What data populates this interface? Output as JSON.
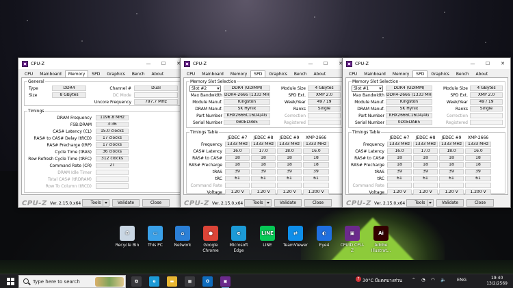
{
  "windows": [
    {
      "title": "CPU-Z",
      "active_tab": "Memory",
      "tabs": [
        "CPU",
        "Mainboard",
        "Memory",
        "SPD",
        "Graphics",
        "Bench",
        "About"
      ],
      "general": {
        "title": "General",
        "type_label": "Type",
        "type": "DDR4",
        "size_label": "Size",
        "size": "8 GBytes",
        "channel_label": "Channel #",
        "channel": "Dual",
        "dcmode_label": "DC Mode",
        "dcmode": "",
        "uncore_label": "Uncore Frequency",
        "uncore": "797.7 MHz"
      },
      "timings": {
        "title": "Timings",
        "rows": [
          {
            "label": "DRAM Frequency",
            "value": "1196.8 MHz",
            "disabled": false
          },
          {
            "label": "FSB:DRAM",
            "value": "3:36",
            "disabled": false
          },
          {
            "label": "CAS# Latency (CL)",
            "value": "15.0 clocks",
            "disabled": false
          },
          {
            "label": "RAS# to CAS# Delay (tRCD)",
            "value": "17 clocks",
            "disabled": false
          },
          {
            "label": "RAS# Precharge (tRP)",
            "value": "17 clocks",
            "disabled": false
          },
          {
            "label": "Cycle Time (tRAS)",
            "value": "36 clocks",
            "disabled": false
          },
          {
            "label": "Row Refresh Cycle Time (tRFC)",
            "value": "312 clocks",
            "disabled": false
          },
          {
            "label": "Command Rate (CR)",
            "value": "2T",
            "disabled": false
          },
          {
            "label": "DRAM Idle Timer",
            "value": "",
            "disabled": true
          },
          {
            "label": "Total CAS# (tRDRAM)",
            "value": "",
            "disabled": true
          },
          {
            "label": "Row To Column (tRCD)",
            "value": "",
            "disabled": true
          }
        ]
      },
      "footer": {
        "brand": "CPU-Z",
        "version": "Ver. 2.15.0.x64",
        "tools": "Tools",
        "validate": "Validate",
        "close": "Close"
      }
    },
    {
      "title": "CPU-Z",
      "active_tab": "SPD",
      "tabs": [
        "CPU",
        "Mainboard",
        "Memory",
        "SPD",
        "Graphics",
        "Bench",
        "About"
      ],
      "slot": {
        "group_title": "Memory Slot Selection",
        "slot": "Slot #2",
        "type": "DDR4 (UDIMM)",
        "left_rows": [
          {
            "label": "Max Bandwidth",
            "value": "DDR4-2666 (1333 MHz)"
          },
          {
            "label": "Module Manuf.",
            "value": "Kingston"
          },
          {
            "label": "DRAM Manuf.",
            "value": "SK Hynix"
          },
          {
            "label": "Part Number",
            "value": "KHX2666C16D4/4G"
          },
          {
            "label": "Serial Number",
            "value": "0B0ED3B5"
          }
        ],
        "right_rows": [
          {
            "label": "Module Size",
            "value": "4 GBytes",
            "disabled": false
          },
          {
            "label": "SPD Ext.",
            "value": "XMP 2.0",
            "disabled": false
          },
          {
            "label": "Week/Year",
            "value": "49 / 19",
            "disabled": false
          },
          {
            "label": "Ranks",
            "value": "Single",
            "disabled": false
          },
          {
            "label": "Correction",
            "value": "",
            "disabled": true
          },
          {
            "label": "Registered",
            "value": "",
            "disabled": true
          }
        ]
      },
      "timings_table": {
        "title": "Timings Table",
        "columns": [
          "JEDEC #7",
          "JEDEC #8",
          "JEDEC #9",
          "XMP-2666"
        ],
        "rows": [
          {
            "label": "Frequency",
            "values": [
              "1333 MHz",
              "1333 MHz",
              "1333 MHz",
              "1333 MHz"
            ],
            "disabled": false
          },
          {
            "label": "CAS# Latency",
            "values": [
              "16.0",
              "17.0",
              "18.0",
              "16.0"
            ],
            "disabled": false
          },
          {
            "label": "RAS# to CAS#",
            "values": [
              "18",
              "18",
              "18",
              "18"
            ],
            "disabled": false
          },
          {
            "label": "RAS# Precharge",
            "values": [
              "18",
              "18",
              "18",
              "18"
            ],
            "disabled": false
          },
          {
            "label": "tRAS",
            "values": [
              "39",
              "39",
              "39",
              "39"
            ],
            "disabled": false
          },
          {
            "label": "tRC",
            "values": [
              "61",
              "61",
              "61",
              "61"
            ],
            "disabled": false
          },
          {
            "label": "Command Rate",
            "values": [
              "",
              "",
              "",
              ""
            ],
            "disabled": true
          },
          {
            "label": "Voltage",
            "values": [
              "1.20 V",
              "1.20 V",
              "1.20 V",
              "1.200 V"
            ],
            "disabled": false
          }
        ]
      },
      "footer": {
        "brand": "CPU-Z",
        "version": "Ver. 2.15.0.x64",
        "tools": "Tools",
        "validate": "Validate",
        "close": "Close"
      }
    },
    {
      "title": "CPU-Z",
      "active_tab": "SPD",
      "tabs": [
        "CPU",
        "Mainboard",
        "Memory",
        "SPD",
        "Graphics",
        "Bench",
        "About"
      ],
      "slot": {
        "group_title": "Memory Slot Selection",
        "slot": "Slot #1",
        "type": "DDR4 (UDIMM)",
        "left_rows": [
          {
            "label": "Max Bandwidth",
            "value": "DDR4-2666 (1333 MHz)"
          },
          {
            "label": "Module Manuf.",
            "value": "Kingston"
          },
          {
            "label": "DRAM Manuf.",
            "value": "SK Hynix"
          },
          {
            "label": "Part Number",
            "value": "KHX2666C16D4/4G"
          },
          {
            "label": "Serial Number",
            "value": "0D0EDAB5"
          }
        ],
        "right_rows": [
          {
            "label": "Module Size",
            "value": "4 GBytes",
            "disabled": false
          },
          {
            "label": "SPD Ext.",
            "value": "XMP 2.0",
            "disabled": false
          },
          {
            "label": "Week/Year",
            "value": "49 / 19",
            "disabled": false
          },
          {
            "label": "Ranks",
            "value": "Single",
            "disabled": false
          },
          {
            "label": "Correction",
            "value": "",
            "disabled": true
          },
          {
            "label": "Registered",
            "value": "",
            "disabled": true
          }
        ]
      },
      "timings_table": {
        "title": "Timings Table",
        "columns": [
          "JEDEC #7",
          "JEDEC #8",
          "JEDEC #9",
          "XMP-2666"
        ],
        "rows": [
          {
            "label": "Frequency",
            "values": [
              "1333 MHz",
              "1333 MHz",
              "1333 MHz",
              "1333 MHz"
            ],
            "disabled": false
          },
          {
            "label": "CAS# Latency",
            "values": [
              "16.0",
              "17.0",
              "18.0",
              "16.0"
            ],
            "disabled": false
          },
          {
            "label": "RAS# to CAS#",
            "values": [
              "18",
              "18",
              "18",
              "18"
            ],
            "disabled": false
          },
          {
            "label": "RAS# Precharge",
            "values": [
              "18",
              "18",
              "18",
              "18"
            ],
            "disabled": false
          },
          {
            "label": "tRAS",
            "values": [
              "39",
              "39",
              "39",
              "39"
            ],
            "disabled": false
          },
          {
            "label": "tRC",
            "values": [
              "61",
              "61",
              "61",
              "61"
            ],
            "disabled": false
          },
          {
            "label": "Command Rate",
            "values": [
              "",
              "",
              "",
              ""
            ],
            "disabled": true
          },
          {
            "label": "Voltage",
            "values": [
              "1.20 V",
              "1.20 V",
              "1.20 V",
              "1.200 V"
            ],
            "disabled": false
          }
        ]
      },
      "footer": {
        "brand": "CPU-Z",
        "version": "Ver. 2.15.0.x64",
        "tools": "Tools",
        "validate": "Validate",
        "close": "Close"
      }
    }
  ],
  "desktop_icons": [
    {
      "label": "Recycle Bin",
      "icon": "recycle-bin-icon",
      "color": "#c9d6e3",
      "glyph": "♻"
    },
    {
      "label": "This PC",
      "icon": "computer-icon",
      "color": "#3aa0e8",
      "glyph": "▭"
    },
    {
      "label": "Network",
      "icon": "network-icon",
      "color": "#2b7fd6",
      "glyph": "⌂"
    },
    {
      "label": "Google Chrome",
      "icon": "chrome-icon",
      "color": "#db4437",
      "glyph": "●"
    },
    {
      "label": "Microsoft Edge",
      "icon": "edge-icon",
      "color": "#1c9ad6",
      "glyph": "e"
    },
    {
      "label": "LINE",
      "icon": "line-icon",
      "color": "#06c755",
      "glyph": "LINE"
    },
    {
      "label": "TeamViewer",
      "icon": "teamviewer-icon",
      "color": "#0e8ee9",
      "glyph": "⇄"
    },
    {
      "label": "Eye4",
      "icon": "eye4-icon",
      "color": "#1f6fe0",
      "glyph": "◐"
    },
    {
      "label": "CPUID CPU-Z",
      "icon": "cpuz-icon",
      "color": "#6b2a8c",
      "glyph": "▣"
    },
    {
      "label": "Adobe Illustrat...",
      "icon": "illustrator-icon",
      "color": "#330000",
      "glyph": "Ai"
    }
  ],
  "taskbar": {
    "search_placeholder": "Type here to search",
    "apps": [
      {
        "icon": "task-view-icon",
        "color": "#3a3a3e",
        "glyph": "⧉"
      },
      {
        "icon": "edge-taskbar-icon",
        "color": "#1c9ad6",
        "glyph": "e"
      },
      {
        "icon": "file-explorer-icon",
        "color": "#e8b632",
        "glyph": "▬"
      },
      {
        "icon": "store-icon",
        "color": "#3a3a3e",
        "glyph": "▦"
      },
      {
        "icon": "outlook-icon",
        "color": "#0f6cbd",
        "glyph": "O"
      },
      {
        "icon": "cpuz-taskbar-icon",
        "color": "#6b2a8c",
        "glyph": "▣"
      }
    ],
    "weather_badge": "7",
    "weather": "30°C มีแดดบางส่วน",
    "language": "ENG",
    "time": "19:40",
    "date": "13/2/2569"
  }
}
